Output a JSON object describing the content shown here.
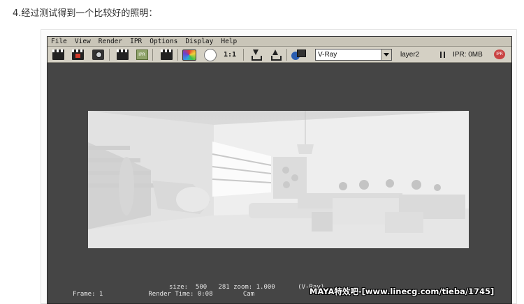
{
  "heading": "4.经过测试得到一个比较好的照明：",
  "menu": [
    "File",
    "View",
    "Render",
    "IPR",
    "Options",
    "Display",
    "Help"
  ],
  "toolbar": {
    "icons": [
      "redo-render-icon",
      "render-region-icon",
      "snapshot-icon",
      "ipr-render-icon",
      "ipr-icon",
      "render-all-icon",
      "color-channels-icon",
      "alpha-channel-icon",
      "keep-image-icon",
      "remove-image-icon",
      "render-view-icon"
    ],
    "ratio_label": "1:1",
    "ipr_small_label": "IPR",
    "renderer": "V-Ray",
    "layer": "layer2",
    "ipr_memory": "IPR: 0MB",
    "ipr_badge": "IPR"
  },
  "status": {
    "line1": "size:  500   281 zoom: 1.000      (V-Ray)",
    "frame": "Frame: 1",
    "render_time": "Render Time: 0:08",
    "camera": "Cam"
  },
  "watermark": "MAYA特效吧-[www.linecg.com/tieba/1745]"
}
